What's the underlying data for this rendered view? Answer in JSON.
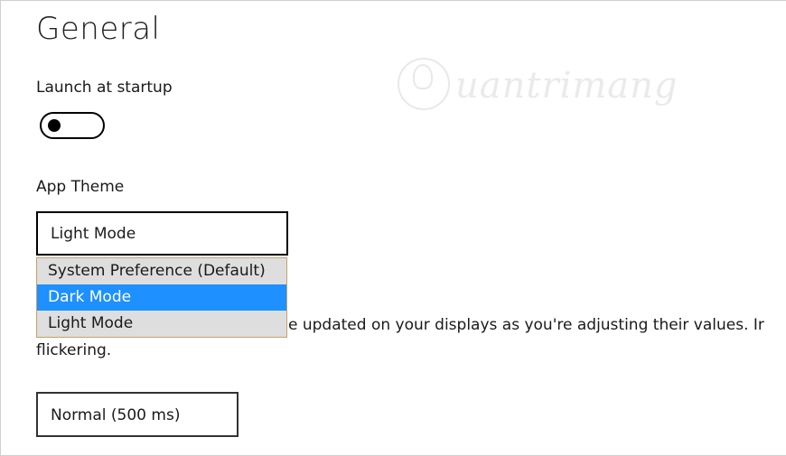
{
  "header": {
    "title": "General"
  },
  "startup": {
    "label": "Launch at startup",
    "toggle_state": "off"
  },
  "watermark": {
    "text": "uantrimang",
    "icon": "lightbulb-circle-icon"
  },
  "theme": {
    "label": "App Theme",
    "selected": "Light Mode",
    "options": [
      "System Preference (Default)",
      "Dark Mode",
      "Light Mode"
    ],
    "highlighted_index": 1
  },
  "update": {
    "description_visible": "e updated on your displays as you're adjusting their values. Ir",
    "description_line2": "flickering.",
    "interval_selected": "Normal (500 ms)"
  },
  "colors": {
    "highlight": "#1e90ff",
    "menu_bg": "#dedede",
    "menu_border": "#c8a06a"
  }
}
